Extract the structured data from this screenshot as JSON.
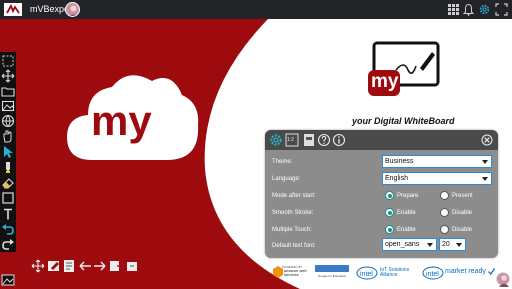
{
  "topbar": {
    "app_title": "mVBexpert",
    "icons": [
      "app-logo",
      "avatar",
      "grid-icon",
      "bell-icon",
      "gear-icon",
      "expand-icon"
    ]
  },
  "background": {
    "accent_color": "#9e0b0f",
    "logo_text": "my"
  },
  "board_logo": {
    "text": "my"
  },
  "tagline": "your Digital WhiteBoard",
  "left_toolbar": {
    "tools": [
      "select-icon",
      "move-icon",
      "folder-icon",
      "image-icon",
      "globe-icon",
      "hand-icon",
      "pointer-icon",
      "highlighter-icon",
      "eraser-icon",
      "rectangle-icon",
      "text-icon",
      "undo-icon",
      "redo-icon"
    ]
  },
  "bottom_tools": [
    "move-icon",
    "board-edit-icon",
    "document-icon",
    "arrow-left-icon",
    "arrow-right-icon",
    "forward-icon",
    "export-icon"
  ],
  "settings": {
    "header_icons": [
      "settings-icon",
      "zoom-icon",
      "ppt-icon",
      "help-icon",
      "info-icon",
      "close-icon"
    ],
    "zoom_label": "1:2",
    "theme_label": "Theme:",
    "theme_value": "Business",
    "language_label": "Language:",
    "language_value": "English",
    "mode_label": "Mode after start:",
    "mode_options": [
      "Prepare",
      "Present"
    ],
    "mode_selected": "Prepare",
    "smooth_label": "Smooth Stroke:",
    "smooth_options": [
      "Enable",
      "Disable"
    ],
    "smooth_selected": "Enable",
    "touch_label": "Multiple Touch:",
    "touch_options": [
      "Enable",
      "Disable"
    ],
    "touch_selected": "Enable",
    "font_label": "Default text font:",
    "font_value": "open_sans",
    "font_size_value": "20"
  },
  "partners": {
    "aws": "amazon web services",
    "aws_top": "POWERED BY",
    "google": "Google for Education",
    "intel_iot": "IoT Solutions Alliance",
    "intel_market": "market ready"
  }
}
